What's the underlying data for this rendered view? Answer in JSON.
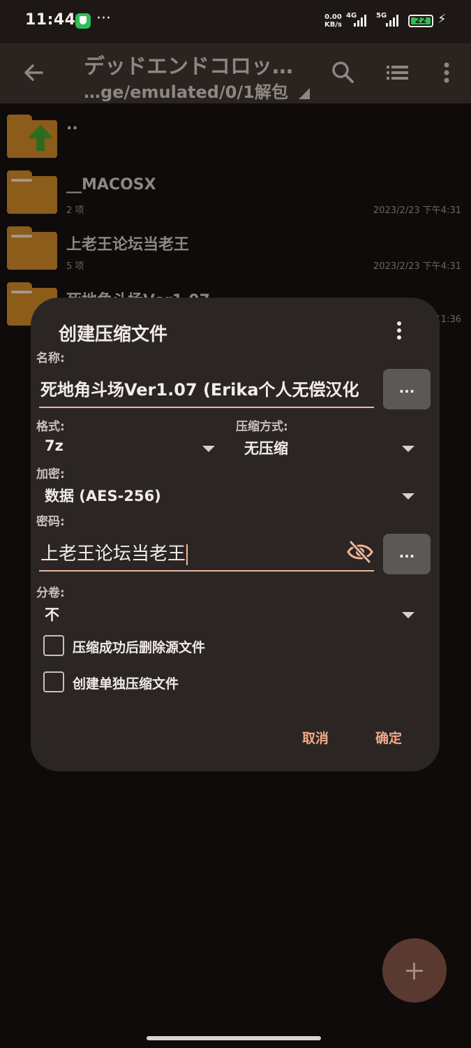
{
  "status_bar": {
    "time": "11:44",
    "dots": "···",
    "net_speed_value": "0.00",
    "net_speed_unit": "KB/s",
    "net_4g": "4G",
    "net_5g": "5G",
    "battery": "22"
  },
  "app_bar": {
    "title": "デッドエンドコロッ…",
    "path": "…ge/emulated/0/1解包"
  },
  "files": [
    {
      "name": "..",
      "count": "",
      "date": ""
    },
    {
      "name": "__MACOSX",
      "count": "2 项",
      "date": "2023/2/23 下午4:31"
    },
    {
      "name": "上老王论坛当老王",
      "count": "5 项",
      "date": "2023/2/23 下午4:31"
    },
    {
      "name": "死地角斗场Ver1.07",
      "count": "",
      "date": "11:36"
    }
  ],
  "dialog": {
    "title": "创建压缩文件",
    "name_label": "名称:",
    "name_value": "死地角斗场Ver1.07 (Erika个人无偿汉化",
    "browse_label": "...",
    "format_label": "格式:",
    "format_value": "7z",
    "compression_label": "压缩方式:",
    "compression_value": "无压缩",
    "encryption_label": "加密:",
    "encryption_value": "数据 (AES-256)",
    "password_label": "密码:",
    "password_value": "上老王论坛当老王",
    "split_label": "分卷:",
    "split_value": "不",
    "delete_source_label": "压缩成功后删除源文件",
    "separate_archive_label": "创建单独压缩文件",
    "cancel_label": "取消",
    "ok_label": "确定"
  },
  "colors": {
    "accent": "#f3a98a",
    "dialog_bg": "#2b2624",
    "folder": "#8c5c1a"
  }
}
